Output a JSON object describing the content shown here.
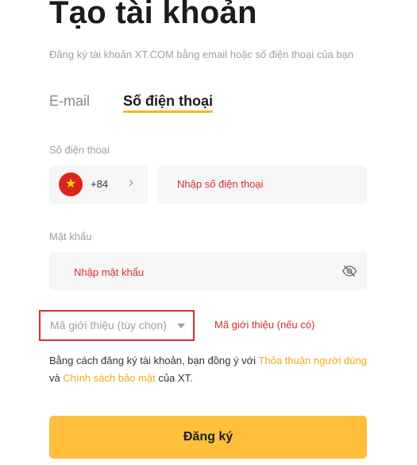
{
  "header": {
    "title": "Tạo tài khoản",
    "subtitle": "Đăng ký tài khoản XT.COM bằng email hoặc số điện thoại của bạn"
  },
  "tabs": [
    {
      "label": "E-mail",
      "active": false
    },
    {
      "label": "Số điện thoại",
      "active": true
    }
  ],
  "phone": {
    "label": "Số điện thoại",
    "country_code": "+84",
    "flag_icon": "vietnam-flag-icon",
    "placeholder_annotation": "Nhập số điện thoại"
  },
  "password": {
    "label": "Mật khẩu",
    "placeholder_annotation": "Nhập mật khẩu",
    "visibility_icon": "eye-off-icon"
  },
  "referral": {
    "label": "Mã giới thiệu (tùy chọn)",
    "annotation": "Mã giới thiệu (nếu có)"
  },
  "terms": {
    "prefix": "Bằng cách đăng ký tài khoản, bạn đồng ý với ",
    "user_agreement": "Thỏa thuận người dùng",
    "and": " và ",
    "privacy_policy": "Chính sách bảo mật",
    "suffix": " của XT."
  },
  "submit": {
    "label": "Đăng ký"
  },
  "colors": {
    "accent": "#fdbf3c",
    "link": "#f0a91f",
    "annotation_red": "#d32f2f",
    "input_bg": "#f6f6f6"
  }
}
